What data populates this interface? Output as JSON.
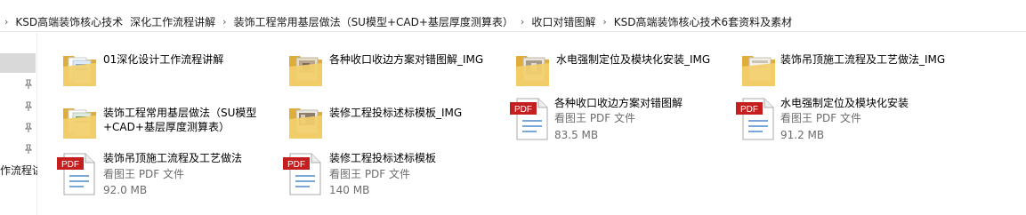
{
  "breadcrumb": [
    "KSD高端装饰核心技术",
    "深化工作流程讲解",
    "装饰工程常用基层做法（SU模型+CAD+基层厚度测算表）",
    "收口对错图解",
    "KSD高端装饰核心技术6套资料及素材"
  ],
  "nav_label": "作流程讲",
  "folders": [
    {
      "name": "01深化设计工作流程讲解",
      "icon": "folder-docs-icon"
    },
    {
      "name": "各种收口收边方案对错图解_IMG",
      "icon": "folder-images-icon"
    },
    {
      "name": "水电强制定位及模块化安装_IMG",
      "icon": "folder-images-icon"
    },
    {
      "name": "装饰吊顶施工流程及工艺做法_IMG",
      "icon": "folder-images-icon"
    },
    {
      "name_line1": "装饰工程常用基层做法（SU模型",
      "name_line2": "+CAD+基层厚度测算表）",
      "icon": "folder-docs-icon"
    },
    {
      "name": "装修工程投标述标模板_IMG",
      "icon": "folder-images-icon"
    }
  ],
  "files": [
    {
      "name": "各种收口收边方案对错图解",
      "type": "看图王 PDF 文件",
      "size": "83.5 MB",
      "badge": "PDF"
    },
    {
      "name": "水电强制定位及模块化安装",
      "type": "看图王 PDF 文件",
      "size": "91.2 MB",
      "badge": "PDF"
    },
    {
      "name": "装饰吊顶施工流程及工艺做法",
      "type": "看图王 PDF 文件",
      "size": "92.0 MB",
      "badge": "PDF"
    },
    {
      "name": "装修工程投标述标模板",
      "type": "看图王 PDF 文件",
      "size": "140 MB",
      "badge": "PDF"
    }
  ],
  "colors": {
    "pdf_badge": "#c41e1e",
    "folder_yellow": "#f3cf6b",
    "folder_dark": "#e0ad3a",
    "selected_nav": "#d9d9d9"
  }
}
